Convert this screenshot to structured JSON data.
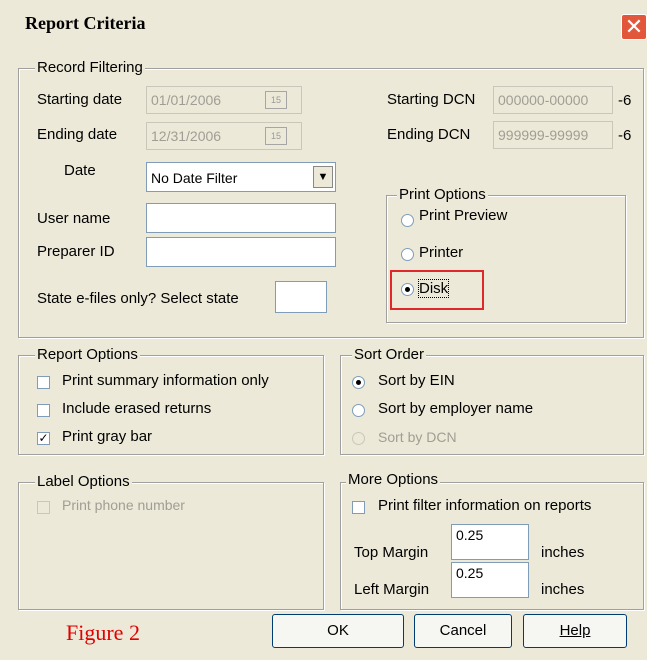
{
  "window": {
    "title": "Report Criteria",
    "close_glyph": "✕"
  },
  "record_filtering": {
    "legend": "Record Filtering",
    "starting_date": {
      "label": "Starting date",
      "value": "01/01/2006"
    },
    "ending_date": {
      "label": "Ending date",
      "value": "12/31/2006"
    },
    "date": {
      "label": "Date",
      "selected": "No Date Filter",
      "arrow": "▼"
    },
    "user_name": {
      "label": "User name",
      "value": ""
    },
    "preparer_id": {
      "label": "Preparer ID",
      "value": ""
    },
    "state_efiles": {
      "label": "State e-files only? Select state",
      "value": ""
    },
    "starting_dcn": {
      "label": "Starting DCN",
      "value": "000000-00000",
      "suffix": "-6"
    },
    "ending_dcn": {
      "label": "Ending DCN",
      "value": "999999-99999",
      "suffix": "-6"
    },
    "calendar_glyph": "15"
  },
  "print_options": {
    "legend": "Print Options",
    "options": [
      "Print Preview",
      "Printer",
      "Disk"
    ],
    "selected": "Disk"
  },
  "report_options": {
    "legend": "Report Options",
    "items": [
      {
        "label": "Print summary information only",
        "checked": false
      },
      {
        "label": "Include erased returns",
        "checked": false
      },
      {
        "label": "Print gray bar",
        "checked": true
      }
    ],
    "check_glyph": "✓"
  },
  "sort_order": {
    "legend": "Sort Order",
    "options": [
      "Sort by EIN",
      "Sort by employer name",
      "Sort by DCN"
    ],
    "selected": "Sort by EIN"
  },
  "label_options": {
    "legend": "Label Options",
    "items": [
      {
        "label": "Print phone number",
        "checked": false,
        "disabled": true
      }
    ]
  },
  "more_options": {
    "legend": "More Options",
    "print_filter": {
      "label": "Print filter information on reports",
      "checked": false
    },
    "top_margin": {
      "label": "Top Margin",
      "value": "0.25",
      "unit": "inches"
    },
    "left_margin": {
      "label": "Left Margin",
      "value": "0.25",
      "unit": "inches"
    }
  },
  "buttons": {
    "ok": "OK",
    "cancel": "Cancel",
    "help": "Help"
  },
  "caption": "Figure 2"
}
